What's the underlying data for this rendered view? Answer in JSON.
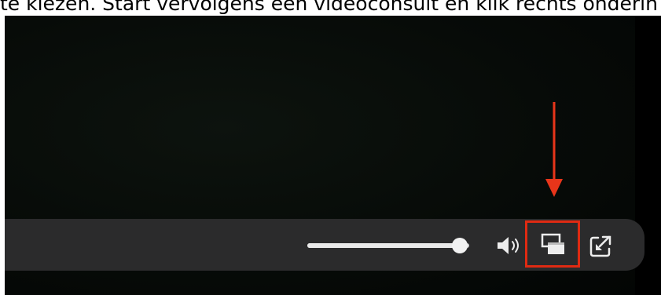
{
  "caption": {
    "text": "te kiezen. Start vervolgens een videoconsult en klik rechts onderin op "
  },
  "annotation": {
    "arrow_color": "#e8351a",
    "highlight_color": "#e02a12"
  },
  "player": {
    "volume_level": 0.94,
    "controls": {
      "volume_slider": "volume-slider",
      "volume_icon": "speaker-volume-icon",
      "pip_icon": "picture-in-picture-icon",
      "popout_icon": "open-external-icon"
    },
    "colors": {
      "video_bg": "#050806",
      "bar_bg": "#2b2b2c",
      "icon": "#ededed"
    }
  }
}
